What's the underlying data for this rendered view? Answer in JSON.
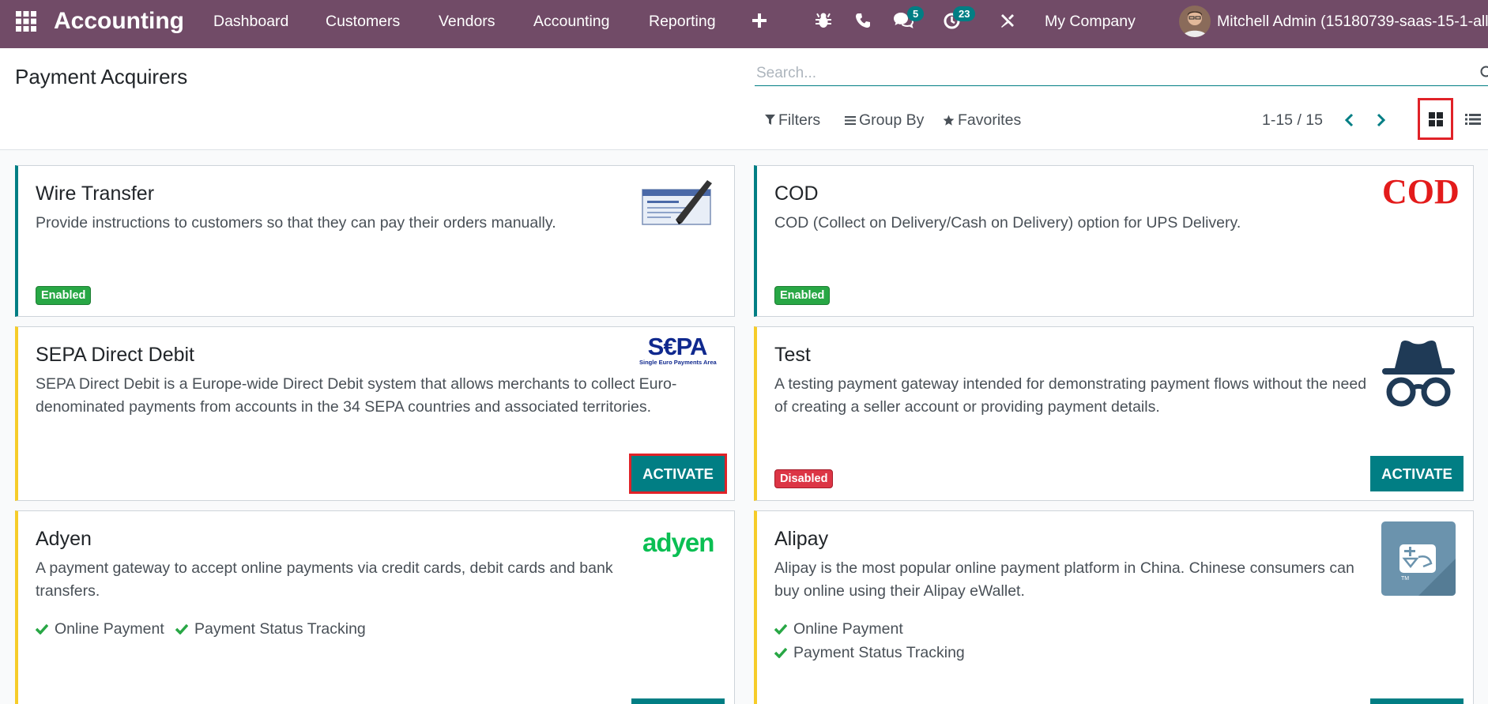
{
  "navbar": {
    "app_title": "Accounting",
    "menu": [
      "Dashboard",
      "Customers",
      "Vendors",
      "Accounting",
      "Reporting"
    ],
    "add_icon": "plus-icon",
    "icons": [
      "bug-icon",
      "phone-icon",
      "chat-icon",
      "activity-icon",
      "tools-icon"
    ],
    "chat_badge": "5",
    "activity_badge": "23",
    "company": "My Company",
    "user": "Mitchell Admin (15180739-saas-15-1-all"
  },
  "control_panel": {
    "title": "Payment Acquirers",
    "search_placeholder": "Search...",
    "filters": "Filters",
    "group_by": "Group By",
    "favorites": "Favorites",
    "pager": "1-15 / 15",
    "active_view": "kanban"
  },
  "colors": {
    "brand": "#714b67",
    "accent": "#017e84",
    "enabled": "#28a745",
    "disabled": "#dc3545",
    "highlight": "#e02228"
  },
  "cards": {
    "wire": {
      "title": "Wire Transfer",
      "description": "Provide instructions to customers so that they can pay their orders manually.",
      "status": "Enabled",
      "logo": "cheque-icon"
    },
    "cod": {
      "title": "COD",
      "description": "COD (Collect on Delivery/Cash on Delivery) option for UPS Delivery.",
      "status": "Enabled",
      "logo_text": "COD"
    },
    "sepa": {
      "title": "SEPA Direct Debit",
      "description_lines": [
        "SEPA Direct Debit is a Europe-wide Direct Debit system that allows merchants to collect Euro-",
        "denominated payments from accounts in the 34 SEPA countries and associated territories."
      ],
      "button": "ACTIVATE",
      "logo_text": "S€PA",
      "logo_subtext": "Single Euro Payments Area"
    },
    "test": {
      "title": "Test",
      "description_lines": [
        "A testing payment gateway intended for demonstrating payment flows without the need",
        "of creating a seller account or providing payment details."
      ],
      "status": "Disabled",
      "button": "ACTIVATE",
      "logo": "incognito-icon"
    },
    "adyen": {
      "title": "Adyen",
      "description_lines": [
        "A payment gateway to accept online payments via credit cards, debit cards and bank",
        "transfers."
      ],
      "features": [
        "Online Payment",
        "Payment Status Tracking"
      ],
      "logo_text": "adyen"
    },
    "alipay": {
      "title": "Alipay",
      "description_lines": [
        "Alipay is the most popular online payment platform in China. Chinese consumers can",
        "buy online using their Alipay eWallet."
      ],
      "features": [
        "Online Payment",
        "Payment Status Tracking"
      ],
      "logo": "alipay-icon"
    }
  }
}
